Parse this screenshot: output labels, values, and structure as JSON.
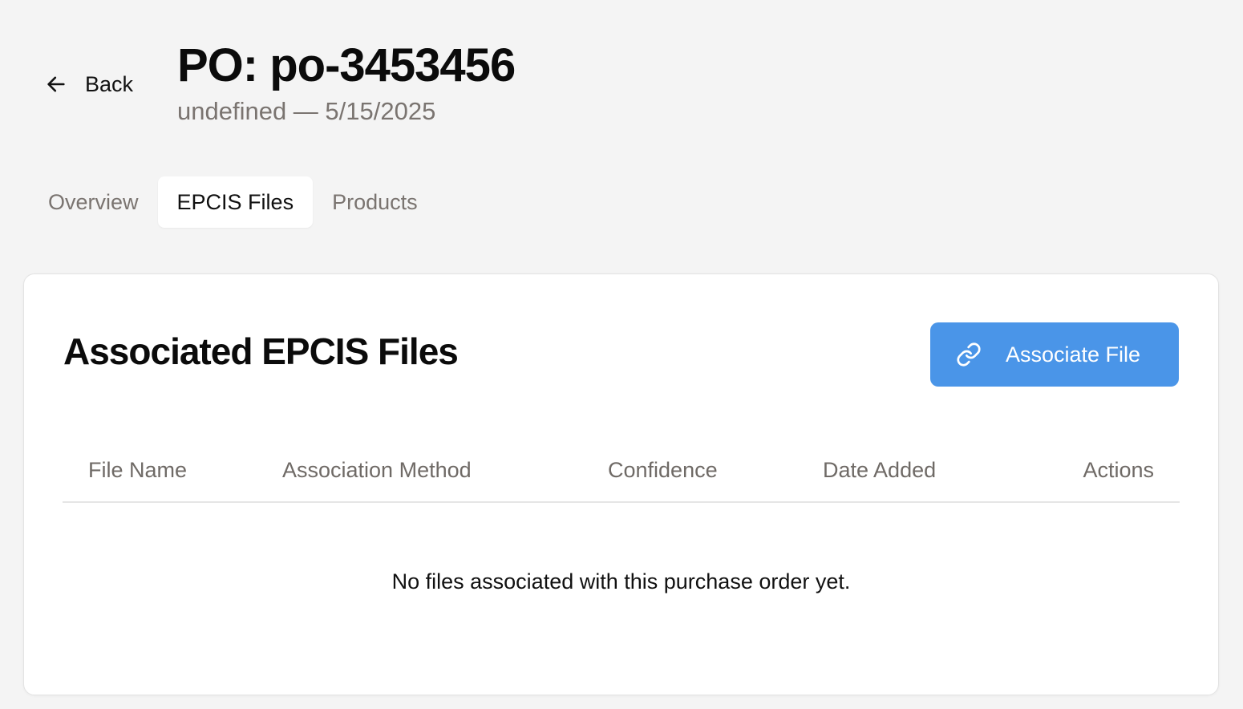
{
  "header": {
    "back_label": "Back",
    "title": "PO: po-3453456",
    "subtitle": "undefined — 5/15/2025"
  },
  "tabs": [
    {
      "label": "Overview",
      "active": false
    },
    {
      "label": "EPCIS Files",
      "active": true
    },
    {
      "label": "Products",
      "active": false
    }
  ],
  "card": {
    "title": "Associated EPCIS Files",
    "associate_button_label": "Associate File",
    "associate_button_icon": "link-icon",
    "accent_color": "#4a95e8"
  },
  "table": {
    "columns": [
      "File Name",
      "Association Method",
      "Confidence",
      "Date Added",
      "Actions"
    ],
    "rows": [],
    "empty_message": "No files associated with this purchase order yet."
  }
}
